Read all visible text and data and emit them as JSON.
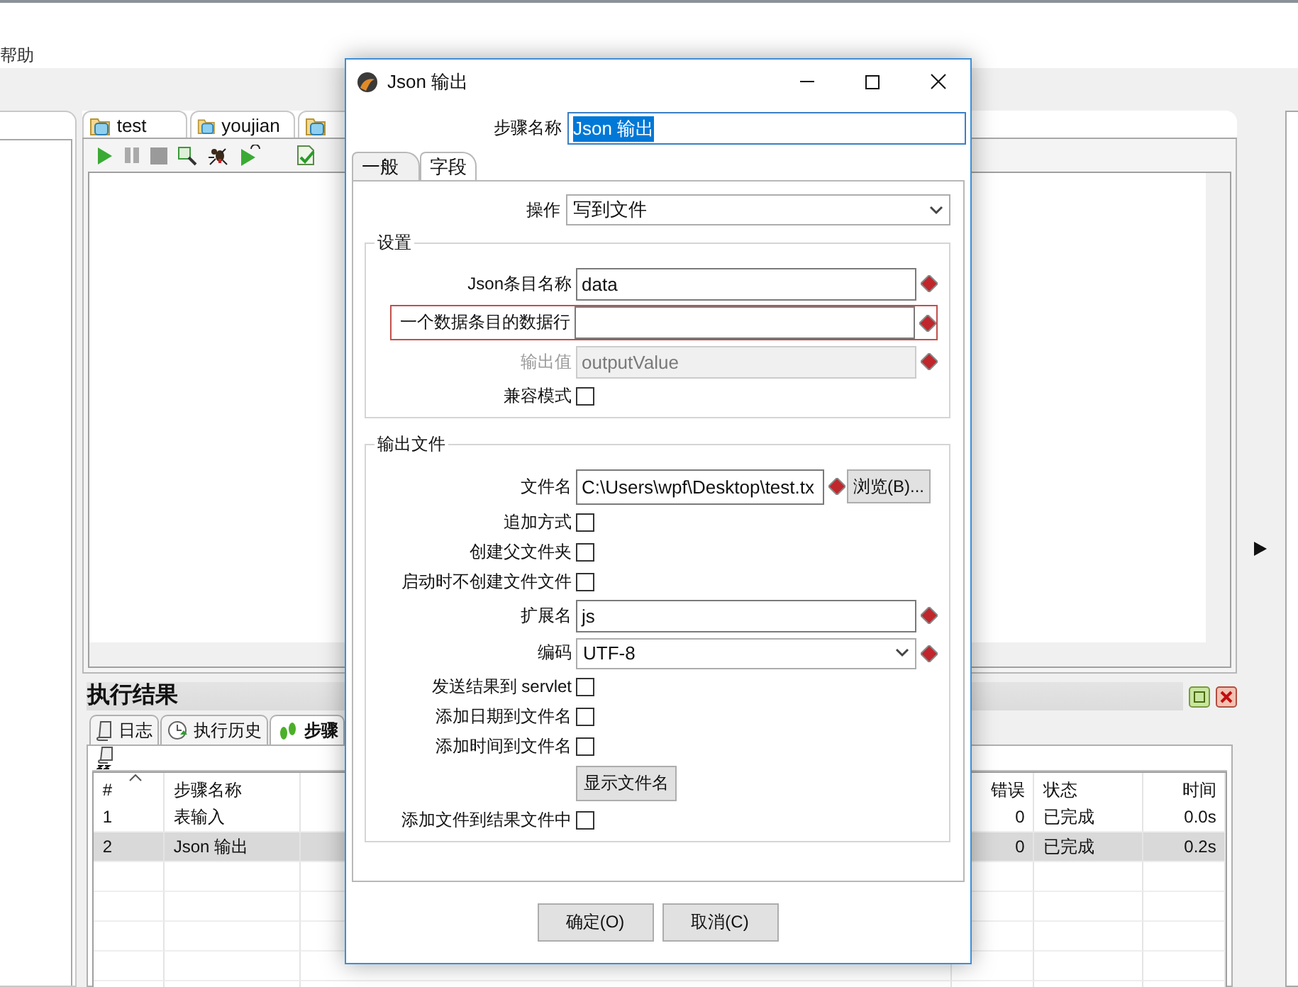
{
  "menu": [
    "帮助"
  ],
  "editor_tabs": [
    {
      "label": "test"
    },
    {
      "label": "youjian"
    }
  ],
  "results": {
    "title": "执行结果",
    "tabs": [
      {
        "label": "日志",
        "selected": false
      },
      {
        "label": "执行历史",
        "selected": false
      },
      {
        "label": "步骤",
        "selected": true
      }
    ],
    "table": {
      "columns": [
        "#",
        "步骤名称",
        "错误",
        "状态",
        "时间"
      ],
      "rows": [
        {
          "cells": [
            "1",
            "表输入",
            "0",
            "已完成",
            "0.0s"
          ],
          "selected": false
        },
        {
          "cells": [
            "2",
            "Json 输出",
            "0",
            "已完成",
            "0.2s"
          ],
          "selected": true
        }
      ]
    }
  },
  "dialog": {
    "title": "Json 输出",
    "step_name": {
      "label": "步骤名称",
      "value": "Json 输出",
      "highlighted": true
    },
    "tabs": [
      {
        "label": "一般",
        "selected": true
      },
      {
        "label": "字段",
        "selected": false
      }
    ],
    "operation": {
      "label": "操作",
      "value": "写到文件"
    },
    "groups": [
      {
        "title": "设置",
        "fields": [
          {
            "kind": "text",
            "label": "Json条目名称",
            "value": "data",
            "variable": true,
            "disabled": false,
            "error": false
          },
          {
            "kind": "text",
            "label": "一个数据条目的数据行",
            "variable": true,
            "disabled": false,
            "error": true
          },
          {
            "kind": "text",
            "label": "输出值",
            "value": "outputValue",
            "variable": true,
            "disabled": true,
            "error": false
          },
          {
            "kind": "checkbox",
            "label": "兼容模式",
            "checked": false
          }
        ]
      },
      {
        "title": "输出文件",
        "fields": [
          {
            "kind": "file",
            "label": "文件名",
            "value": "C:\\Users\\wpf\\Desktop\\test.tx",
            "variable": true,
            "button": "浏览(B)..."
          },
          {
            "kind": "checkbox",
            "label": "追加方式",
            "checked": false
          },
          {
            "kind": "checkbox",
            "label": "创建父文件夹",
            "checked": false
          },
          {
            "kind": "checkbox",
            "label": "启动时不创建文件文件",
            "checked": false
          },
          {
            "kind": "text",
            "label": "扩展名",
            "value": "js",
            "variable": true,
            "disabled": false,
            "error": false
          },
          {
            "kind": "select",
            "label": "编码",
            "value": "UTF-8",
            "variable": true
          },
          {
            "kind": "checkbox",
            "label": "发送结果到 servlet",
            "checked": false
          },
          {
            "kind": "checkbox",
            "label": "添加日期到文件名",
            "checked": false
          },
          {
            "kind": "checkbox",
            "label": "添加时间到文件名",
            "checked": false
          },
          {
            "kind": "button",
            "label": "显示文件名"
          },
          {
            "kind": "checkbox",
            "label": "添加文件到结果文件中",
            "checked": false
          }
        ]
      }
    ],
    "buttons": [
      "确定(O)",
      "取消(C)"
    ]
  }
}
